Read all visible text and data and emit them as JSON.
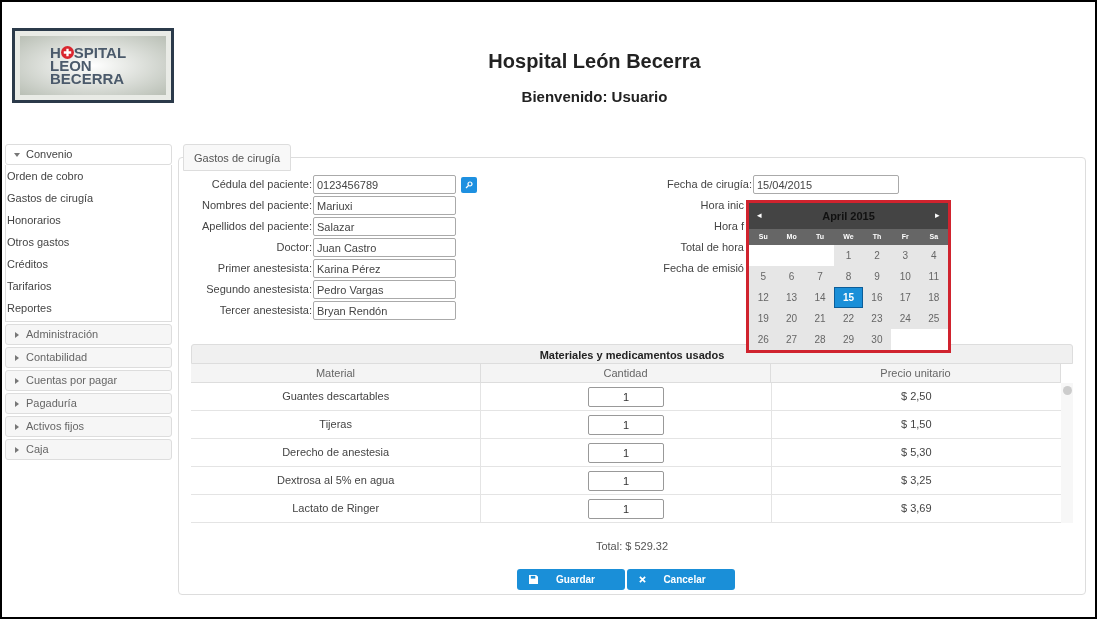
{
  "header": {
    "logo_text": [
      "H",
      "SPITAL",
      "LEON",
      "BECERRA"
    ],
    "title": "Hospital León Becerra",
    "subtitle": "Bienvenido: Usuario"
  },
  "sidebar": {
    "sections": [
      {
        "label": "Convenio",
        "expanded": true,
        "items": [
          "Orden de cobro",
          "Gastos de cirugía",
          "Honorarios",
          "Otros gastos",
          "Créditos",
          "Tarifarios",
          "Reportes"
        ]
      },
      {
        "label": "Administración",
        "expanded": false
      },
      {
        "label": "Contabilidad",
        "expanded": false
      },
      {
        "label": "Cuentas por pagar",
        "expanded": false
      },
      {
        "label": "Pagaduría",
        "expanded": false
      },
      {
        "label": "Activos fijos",
        "expanded": false
      },
      {
        "label": "Caja",
        "expanded": false
      }
    ]
  },
  "tab": {
    "label": "Gastos de cirugía"
  },
  "form_left": [
    {
      "label": "Cédula del paciente:",
      "value": "0123456789",
      "search": true
    },
    {
      "label": "Nombres del paciente:",
      "value": "Mariuxi"
    },
    {
      "label": "Apellidos del paciente:",
      "value": "Salazar"
    },
    {
      "label": "Doctor:",
      "value": "Juan Castro"
    },
    {
      "label": "Primer anestesista:",
      "value": "Karina Pérez"
    },
    {
      "label": "Segundo anestesista:",
      "value": "Pedro Vargas"
    },
    {
      "label": "Tercer anestesista:",
      "value": "Bryan Rendón"
    }
  ],
  "form_right": [
    {
      "label": "Fecha de cirugía:",
      "value": "15/04/2015"
    },
    {
      "label": "Hora inic"
    },
    {
      "label": "Hora f"
    },
    {
      "label": "Total de hora"
    },
    {
      "label": "Fecha de emisió"
    }
  ],
  "datepicker": {
    "prev": "◂",
    "next": "▸",
    "month": "April 2015",
    "weekdays": [
      "Su",
      "Mo",
      "Tu",
      "We",
      "Th",
      "Fr",
      "Sa"
    ],
    "weeks": [
      [
        {
          "label": "1",
          "selected": false
        },
        {
          "label": "2",
          "selected": false
        },
        {
          "label": "3",
          "selected": false
        },
        {
          "label": "4",
          "selected": false
        }
      ],
      [
        {
          "label": "5",
          "selected": false
        },
        {
          "label": "6",
          "selected": false
        },
        {
          "label": "7",
          "selected": false
        },
        {
          "label": "8",
          "selected": false
        },
        {
          "label": "9",
          "selected": false
        },
        {
          "label": "10",
          "selected": false
        },
        {
          "label": "11",
          "selected": false
        }
      ],
      [
        {
          "label": "12",
          "selected": false
        },
        {
          "label": "13",
          "selected": false
        },
        {
          "label": "14",
          "selected": false
        },
        {
          "label": "15",
          "selected": true
        },
        {
          "label": "16",
          "selected": false
        },
        {
          "label": "17",
          "selected": false
        },
        {
          "label": "18",
          "selected": false
        }
      ],
      [
        {
          "label": "19",
          "selected": false
        },
        {
          "label": "20",
          "selected": false
        },
        {
          "label": "21",
          "selected": false
        },
        {
          "label": "22",
          "selected": false
        },
        {
          "label": "23",
          "selected": false
        },
        {
          "label": "24",
          "selected": false
        },
        {
          "label": "25",
          "selected": false
        }
      ],
      [
        {
          "label": "26",
          "selected": false
        },
        {
          "label": "27",
          "selected": false
        },
        {
          "label": "28",
          "selected": false
        },
        {
          "label": "29",
          "selected": false
        },
        {
          "label": "30",
          "selected": false
        }
      ]
    ]
  },
  "table": {
    "title": "Materiales y medicamentos usados",
    "columns": [
      "Material",
      "Cantidad",
      "Precio unitario"
    ],
    "rows": [
      {
        "material": "Guantes descartables",
        "cantidad": "1",
        "precio": "$ 2,50"
      },
      {
        "material": "Tijeras",
        "cantidad": "1",
        "precio": "$ 1,50"
      },
      {
        "material": "Derecho de anestesia",
        "cantidad": "1",
        "precio": "$ 5,30"
      },
      {
        "material": "Dextrosa al 5% en agua",
        "cantidad": "1",
        "precio": "$ 3,25"
      },
      {
        "material": "Lactato de Ringer",
        "cantidad": "1",
        "precio": "$ 3,69"
      }
    ]
  },
  "total": "Total: $ 529.32",
  "buttons": [
    {
      "kind": "save",
      "label": "Guardar"
    },
    {
      "kind": "cancel",
      "label": "Cancelar"
    }
  ]
}
